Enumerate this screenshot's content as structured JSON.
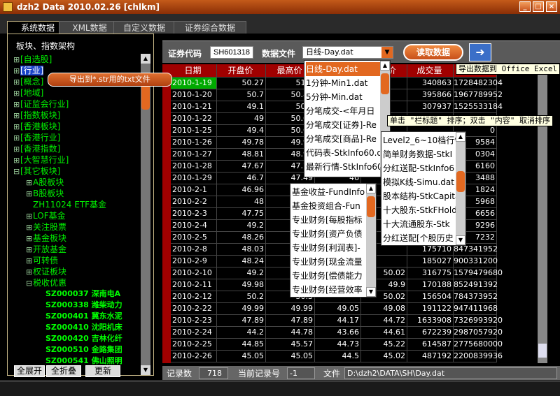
{
  "window": {
    "title": "dzh2 Data 2010.02.26 [chlkm]",
    "minimize": "_",
    "maximize": "□",
    "close": "×"
  },
  "tabs": [
    "系统数据",
    "XML数据",
    "自定义数据",
    "证券综合数据"
  ],
  "left": {
    "group_title": "板块、指数架构",
    "tree": [
      {
        "label": "[自选股]",
        "indent": 0,
        "exp": "⊞"
      },
      {
        "label": "[行业]",
        "indent": 0,
        "exp": "⊞",
        "selected": true
      },
      {
        "label": "[概念]",
        "indent": 0,
        "exp": "⊞"
      },
      {
        "label": "[地域]",
        "indent": 0,
        "exp": "⊞"
      },
      {
        "label": "[证监会行业]",
        "indent": 0,
        "exp": "⊞"
      },
      {
        "label": "[指数板块]",
        "indent": 0,
        "exp": "⊞"
      },
      {
        "label": "[香港板块]",
        "indent": 0,
        "exp": "⊞"
      },
      {
        "label": "[香港行业]",
        "indent": 0,
        "exp": "⊞"
      },
      {
        "label": "[香港指数]",
        "indent": 0,
        "exp": "⊞"
      },
      {
        "label": "[大智慧行业]",
        "indent": 0,
        "exp": "⊞"
      },
      {
        "label": "[其它板块]",
        "indent": 0,
        "exp": "⊟"
      },
      {
        "label": "A股板块",
        "indent": 1,
        "exp": "⊞"
      },
      {
        "label": "B股板块",
        "indent": 1,
        "exp": "⊞"
      },
      {
        "label": "ZH11024 ETF基金",
        "indent": 1,
        "exp": ""
      },
      {
        "label": "LOF基金",
        "indent": 1,
        "exp": "⊞"
      },
      {
        "label": "关注股票",
        "indent": 1,
        "exp": "⊞"
      },
      {
        "label": "基金板块",
        "indent": 1,
        "exp": "⊞"
      },
      {
        "label": "开放基金",
        "indent": 1,
        "exp": "⊞"
      },
      {
        "label": "可转债",
        "indent": 1,
        "exp": "⊞"
      },
      {
        "label": "权证板块",
        "indent": 1,
        "exp": "⊞"
      },
      {
        "label": "税收优惠",
        "indent": 1,
        "exp": "⊟"
      },
      {
        "label": "SZ000037 深南电A",
        "indent": 2,
        "exp": "",
        "leaf": true
      },
      {
        "label": "SZ000338 潍柴动力",
        "indent": 2,
        "exp": "",
        "leaf": true
      },
      {
        "label": "SZ000401 冀东水泥",
        "indent": 2,
        "exp": "",
        "leaf": true
      },
      {
        "label": "SZ000410 沈阳机床",
        "indent": 2,
        "exp": "",
        "leaf": true
      },
      {
        "label": "SZ000420 吉林化纤",
        "indent": 2,
        "exp": "",
        "leaf": true
      },
      {
        "label": "SZ000510 金路集团",
        "indent": 2,
        "exp": "",
        "leaf": true
      },
      {
        "label": "SZ000541 佛山照明",
        "indent": 2,
        "exp": "",
        "leaf": true
      }
    ],
    "expand_all": "全展开",
    "collapse_all": "全折叠",
    "update": "更新"
  },
  "toolbar": {
    "code_label": "证券代码",
    "code_value": "SH601318",
    "file_label": "数据文件",
    "file_value": "日线-Day.dat",
    "read_button": "读取数据",
    "export_icon": "export-icon"
  },
  "grid": {
    "columns": [
      "日期",
      "开盘价",
      "最高价",
      "最低价",
      "收盘价",
      "成交量",
      "成交额"
    ],
    "rows": [
      [
        "2010-1-19",
        "50.27",
        "51.3",
        "",
        "",
        "340863",
        "1728482304"
      ],
      [
        "2010-1-20",
        "50.7",
        "50.83",
        "",
        "",
        "395866",
        "1967789952"
      ],
      [
        "2010-1-21",
        "49.1",
        "50.4",
        "",
        "",
        "307937",
        "1525533184"
      ],
      [
        "2010-1-22",
        "49",
        "50.65",
        "",
        "",
        "",
        "1"
      ],
      [
        "2010-1-25",
        "49.4",
        "50.68",
        "",
        "",
        "",
        "0"
      ],
      [
        "2010-1-26",
        "49.78",
        "49.99",
        "",
        "",
        "",
        "9584"
      ],
      [
        "2010-1-27",
        "48.81",
        "48.95",
        "",
        "",
        "",
        "0304"
      ],
      [
        "2010-1-28",
        "47.67",
        "47.73",
        "",
        "",
        "",
        "6160"
      ],
      [
        "2010-1-29",
        "46.7",
        "47.49",
        "46",
        "",
        "",
        "3488"
      ],
      [
        "2010-2-1",
        "46.96",
        "47",
        "",
        "",
        "",
        "1824"
      ],
      [
        "2010-2-2",
        "48",
        "49",
        "",
        "",
        "",
        "5968"
      ],
      [
        "2010-2-3",
        "47.75",
        "49",
        "",
        "",
        "",
        "6656"
      ],
      [
        "2010-2-4",
        "49.2",
        "49",
        "",
        "",
        "",
        "9296"
      ],
      [
        "2010-2-5",
        "48.26",
        "48",
        "",
        "",
        "",
        "7232"
      ],
      [
        "2010-2-8",
        "48.03",
        "48",
        "",
        "",
        "175710",
        "847341952"
      ],
      [
        "2010-2-9",
        "48.24",
        "48",
        "",
        "",
        "185027",
        "900331200"
      ],
      [
        "2010-2-10",
        "49.2",
        "50",
        "",
        "50.02",
        "316775",
        "1579479680"
      ],
      [
        "2010-2-11",
        "49.98",
        "50",
        "",
        "49.9",
        "170188",
        "852491392"
      ],
      [
        "2010-2-12",
        "50.2",
        "50.3",
        "",
        "50.02",
        "156504",
        "784373952"
      ],
      [
        "2010-2-22",
        "49.99",
        "49.99",
        "49.05",
        "49.08",
        "191122",
        "947411968"
      ],
      [
        "2010-2-23",
        "47.89",
        "47.89",
        "44.17",
        "44.72",
        "1633908",
        "7326993920"
      ],
      [
        "2010-2-24",
        "44.2",
        "44.78",
        "43.66",
        "44.61",
        "672239",
        "2987057920"
      ],
      [
        "2010-2-25",
        "44.85",
        "45.57",
        "44.73",
        "45.22",
        "614587",
        "2775680000"
      ],
      [
        "2010-2-26",
        "45.05",
        "45.05",
        "44.5",
        "45.02",
        "487192",
        "2200839936"
      ]
    ]
  },
  "status": {
    "records_label": "记录数",
    "records_value": "718",
    "current_label": "当前记录号",
    "current_value": "-1",
    "file_label": "文件",
    "file_value": "D:\\dzh2\\DATA\\SH\\Day.dat"
  },
  "tooltips": {
    "export": "导出数据到 Office Excel",
    "sort": "单击 \"栏标题\" 排序；双击 \"内容\" 取消排序"
  },
  "context_menu": {
    "item": "导出到*.str用的txt文件"
  },
  "menu1": [
    "日线-Day.dat",
    "1分钟-Min1.dat",
    "5分钟-Min.dat",
    "分笔成交-<年月日",
    "分笔成交[证券]-Re",
    "分笔成交[商品]-Re",
    "代码表-StkInfo60.d",
    "最新行情-StkInfo60"
  ],
  "menu2": [
    "Level2_6~10档行情",
    "简单财务数据-StkI",
    "分红送配-StkInfo6",
    "模拟K线-Simu.dat",
    "股本结构-StkCapita",
    "十大股东-StkFHold",
    "十大流通股东-Stk",
    "分红送配[个股历史"
  ],
  "menu3": [
    "基金收益-FundInfo",
    "基金投资组合-Fun",
    "专业财务[每股指标",
    "专业财务[资产负债",
    "专业财务[利润表]-",
    "专业财务[现金流量",
    "专业财务[偿债能力",
    "专业财务[经营效率"
  ]
}
